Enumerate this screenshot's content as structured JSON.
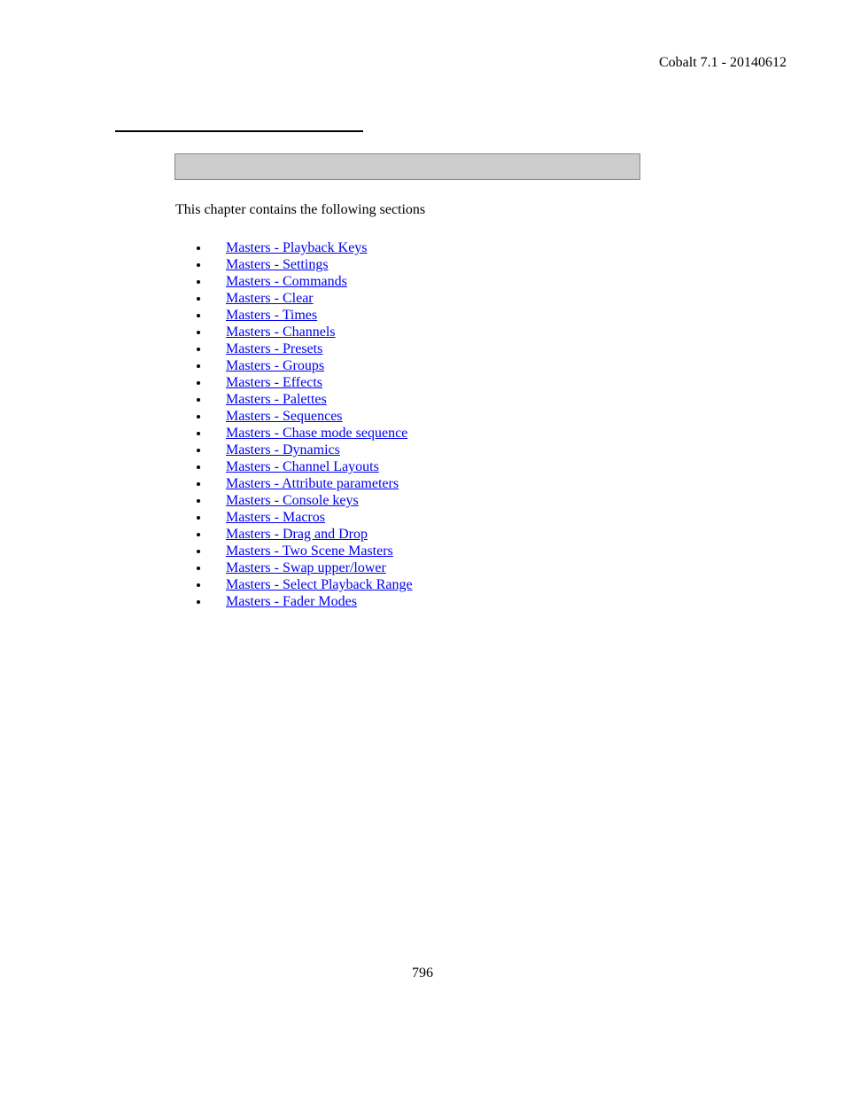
{
  "header": {
    "version": "Cobalt 7.1 - 20140612"
  },
  "intro": {
    "text": "This chapter contains the following sections"
  },
  "links": [
    "Masters - Playback Keys",
    "Masters - Settings",
    "Masters - Commands",
    "Masters - Clear",
    "Masters - Times",
    "Masters - Channels",
    "Masters - Presets",
    "Masters - Groups",
    "Masters - Effects",
    "Masters - Palettes",
    "Masters - Sequences",
    "Masters - Chase mode sequence",
    "Masters - Dynamics",
    "Masters - Channel Layouts",
    "Masters - Attribute parameters",
    "Masters - Console keys",
    "Masters - Macros",
    "Masters - Drag and Drop",
    "Masters - Two Scene Masters",
    "Masters - Swap upper/lower",
    "Masters - Select Playback Range",
    "Masters - Fader Modes"
  ],
  "footer": {
    "page_number": "796"
  }
}
